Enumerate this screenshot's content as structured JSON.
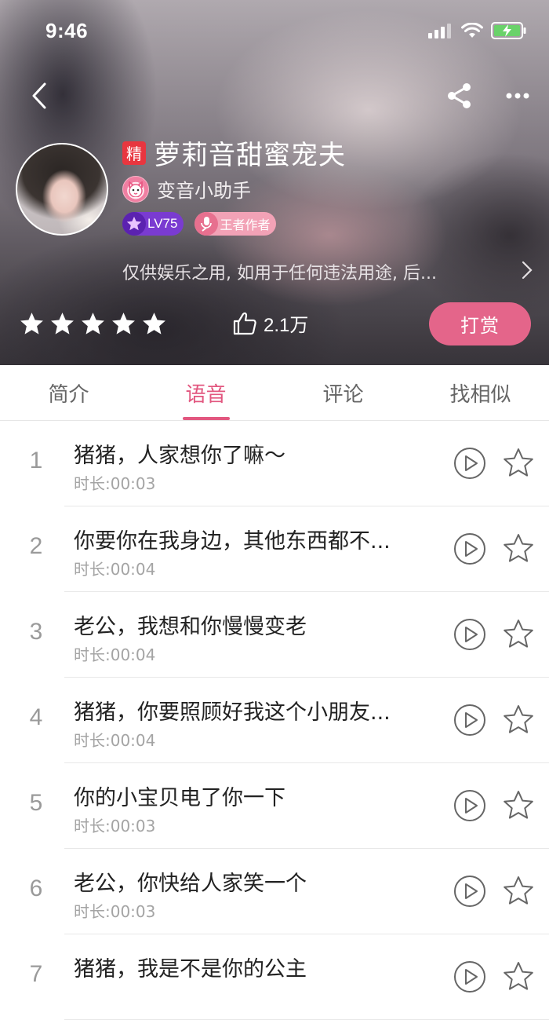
{
  "status_bar": {
    "time": "9:46"
  },
  "header": {
    "badge_jing": "精",
    "title": "萝莉音甜蜜宠夫",
    "author": "变音小助手",
    "level_badge": "LV75",
    "author_badge": "王者作者",
    "disclaimer": "仅供娱乐之用, 如用于任何违法用途, 后...",
    "rating_stars": 5,
    "likes": "2.1万",
    "reward_label": "打赏"
  },
  "tabs": [
    {
      "label": "简介",
      "active": false
    },
    {
      "label": "语音",
      "active": true
    },
    {
      "label": "评论",
      "active": false
    },
    {
      "label": "找相似",
      "active": false
    }
  ],
  "items": [
    {
      "index": "1",
      "title": "猪猪，人家想你了嘛～",
      "duration": "时长:00:03"
    },
    {
      "index": "2",
      "title": "你要你在我身边，其他东西都不...",
      "duration": "时长:00:04"
    },
    {
      "index": "3",
      "title": "老公，我想和你慢慢变老",
      "duration": "时长:00:04"
    },
    {
      "index": "4",
      "title": "猪猪，你要照顾好我这个小朋友...",
      "duration": "时长:00:04"
    },
    {
      "index": "5",
      "title": "你的小宝贝电了你一下",
      "duration": "时长:00:03"
    },
    {
      "index": "6",
      "title": "老公，你快给人家笑一个",
      "duration": "时长:00:03"
    },
    {
      "index": "7",
      "title": "猪猪，我是不是你的公主",
      "duration": ""
    }
  ],
  "colors": {
    "accent": "#e2577f",
    "reward": "#e4658a",
    "jing": "#e8363f",
    "level": "#7a3bd1"
  }
}
